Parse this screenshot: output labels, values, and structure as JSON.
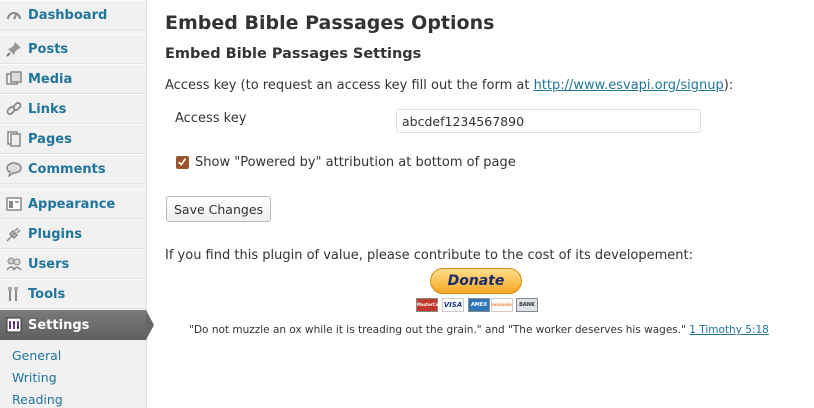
{
  "sidebar": {
    "items": [
      {
        "label": "Dashboard",
        "icon": "dashboard-icon"
      },
      {
        "label": "Posts",
        "icon": "pushpin-icon"
      },
      {
        "label": "Media",
        "icon": "media-icon"
      },
      {
        "label": "Links",
        "icon": "link-icon"
      },
      {
        "label": "Pages",
        "icon": "pages-icon"
      },
      {
        "label": "Comments",
        "icon": "comment-bubble-icon"
      },
      {
        "label": "Appearance",
        "icon": "appearance-icon"
      },
      {
        "label": "Plugins",
        "icon": "plug-icon"
      },
      {
        "label": "Users",
        "icon": "users-icon"
      },
      {
        "label": "Tools",
        "icon": "tools-icon"
      },
      {
        "label": "Settings",
        "icon": "settings-icon"
      }
    ],
    "submenu": [
      "General",
      "Writing",
      "Reading"
    ]
  },
  "page": {
    "title": "Embed Bible Passages Options",
    "section_title": "Embed Bible Passages Settings",
    "access_intro_prefix": "Access key (to request an access key fill out the form at ",
    "access_intro_link": "http://www.esvapi.org/signup",
    "access_intro_suffix": "):",
    "access_key_label": "Access key",
    "access_key_value": "abcdef1234567890",
    "powered_by_label": "Show \"Powered by\" attribution at bottom of page",
    "powered_by_checked": true,
    "save_label": "Save Changes",
    "contribute_text": "If you find this plugin of value, please contribute to the cost of its developement:",
    "donate_label": "Donate",
    "cards": [
      "MasterCard",
      "VISA",
      "AMEX",
      "DISCOVER",
      "BANK"
    ],
    "quote_text": "\"Do not muzzle an ox while it is treading out the grain.\" and \"The worker deserves his wages.\"",
    "quote_ref": "1 Timothy 5:18"
  },
  "colors": {
    "link": "#21759b",
    "active_menu": "#6d6d6d",
    "sidebar_bg": "#f1f1f1"
  }
}
